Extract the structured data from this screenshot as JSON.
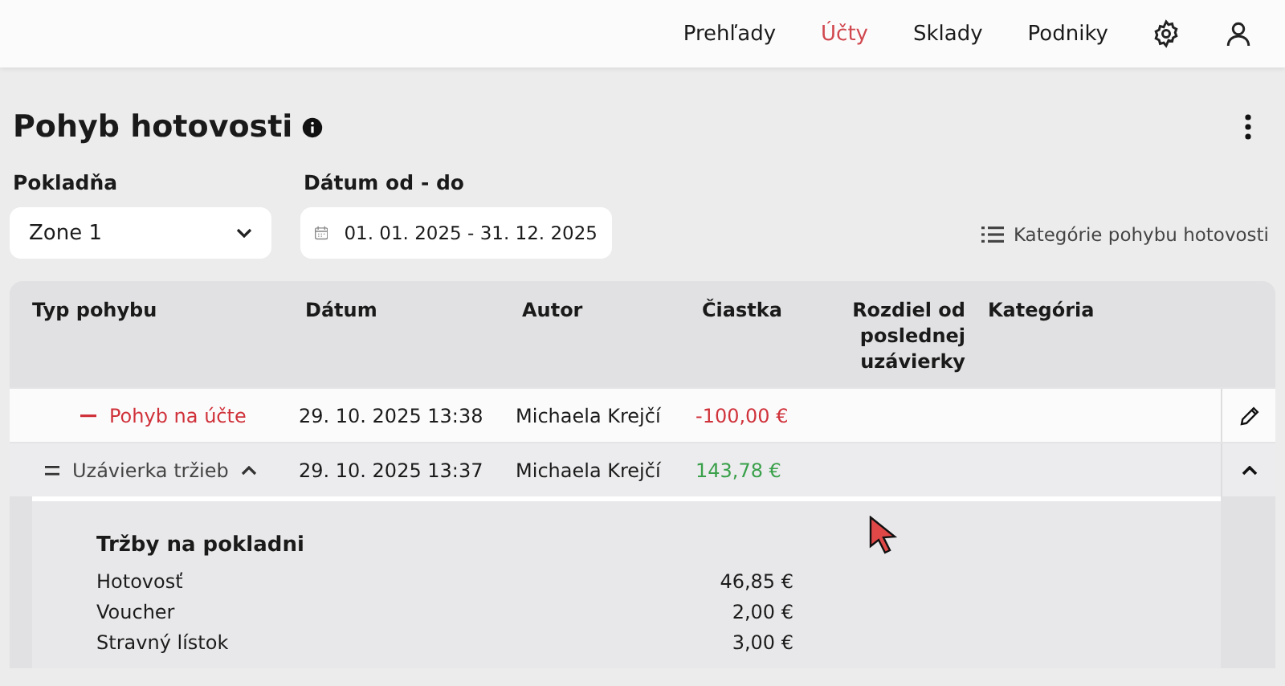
{
  "nav": {
    "items": [
      {
        "label": "Prehľady",
        "selected": false
      },
      {
        "label": "Účty",
        "selected": true
      },
      {
        "label": "Sklady",
        "selected": false
      },
      {
        "label": "Podniky",
        "selected": false
      }
    ]
  },
  "page": {
    "title": "Pohyb hotovosti"
  },
  "filters": {
    "register": {
      "label": "Pokladňa",
      "value": "Zone 1"
    },
    "date_range": {
      "label": "Dátum od - do",
      "value": "01. 01. 2025 - 31. 12. 2025"
    },
    "categories_link": "Kategórie pohybu hotovosti"
  },
  "table": {
    "columns": [
      "Typ pohybu",
      "Dátum",
      "Autor",
      "Čiastka",
      "Rozdiel od poslednej uzávierky",
      "Kategória"
    ],
    "rows": [
      {
        "kind": "movement",
        "type": "Pohyb na účte",
        "date": "29. 10. 2025 13:38",
        "author": "Michaela Krejčí",
        "amount": "-100,00 €",
        "expanded": false
      },
      {
        "kind": "closing",
        "type": "Uzávierka tržieb",
        "date": "29. 10. 2025 13:37",
        "author": "Michaela Krejčí",
        "amount": "143,78 €",
        "expanded": true,
        "detail": {
          "title": "Tržby na pokladni",
          "lines": [
            {
              "label": "Hotovosť",
              "value": "46,85 €"
            },
            {
              "label": "Voucher",
              "value": "2,00 €"
            },
            {
              "label": "Stravný lístok",
              "value": "3,00 €"
            }
          ]
        }
      }
    ]
  }
}
